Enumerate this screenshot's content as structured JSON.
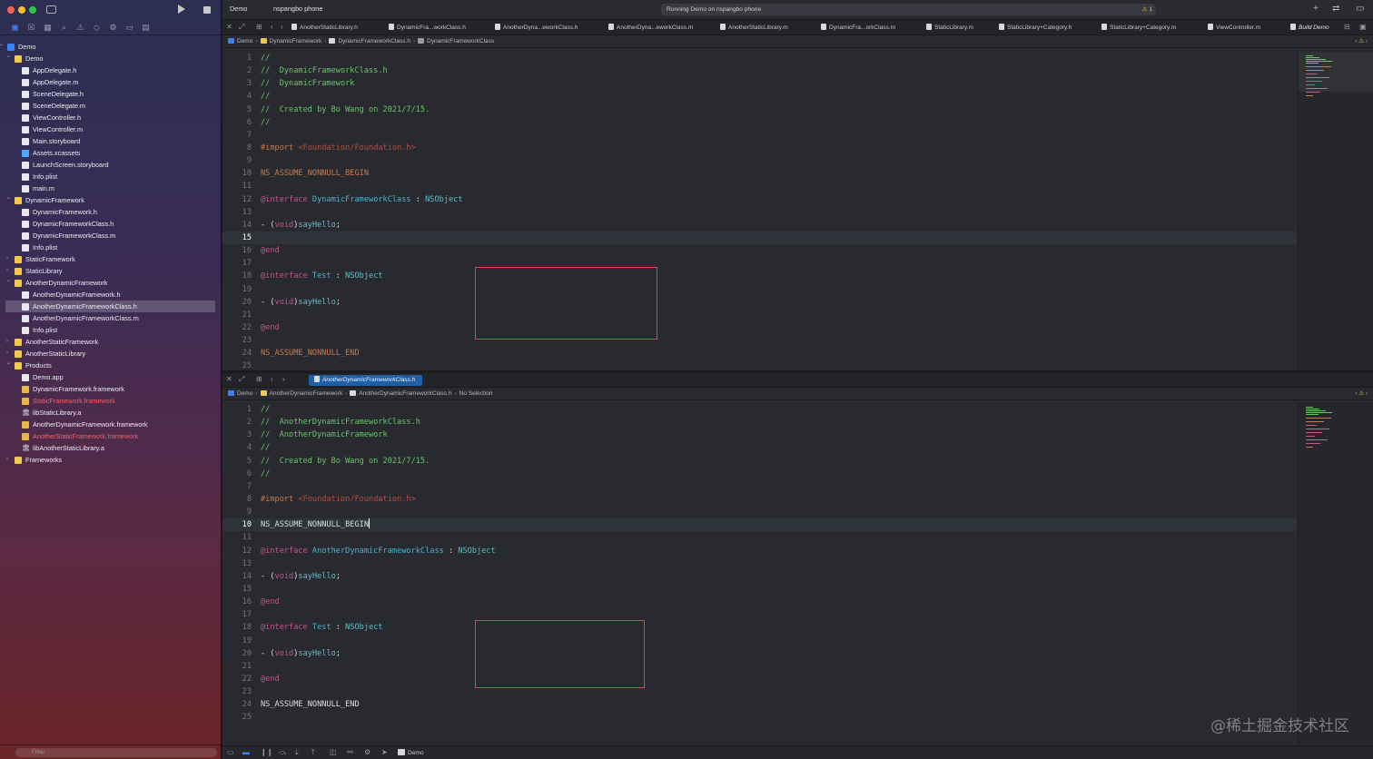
{
  "toolbar": {
    "scheme": "Demo",
    "device": "nspangbo phone",
    "status": "Running Demo on nspangbo phone",
    "warning_count": "1"
  },
  "navigator": {
    "filter_placeholder": "Filter",
    "items": [
      {
        "label": "Demo",
        "icon": "project-icon",
        "depth": 0,
        "chevron": "open"
      },
      {
        "label": "Demo",
        "icon": "folder-icon",
        "depth": 1,
        "chevron": "open"
      },
      {
        "label": "AppDelegate.h",
        "icon": "file-icon",
        "depth": 2
      },
      {
        "label": "AppDelegate.m",
        "icon": "file-icon",
        "depth": 2
      },
      {
        "label": "SceneDelegate.h",
        "icon": "file-icon",
        "depth": 2
      },
      {
        "label": "SceneDelegate.m",
        "icon": "file-icon",
        "depth": 2
      },
      {
        "label": "ViewController.h",
        "icon": "file-icon",
        "depth": 2
      },
      {
        "label": "ViewController.m",
        "icon": "file-icon",
        "depth": 2
      },
      {
        "label": "Main.storyboard",
        "icon": "file-icon",
        "depth": 2
      },
      {
        "label": "Assets.xcassets",
        "icon": "asset-catalog-icon",
        "depth": 2
      },
      {
        "label": "LaunchScreen.storyboard",
        "icon": "file-icon",
        "depth": 2
      },
      {
        "label": "Info.plist",
        "icon": "file-icon",
        "depth": 2
      },
      {
        "label": "main.m",
        "icon": "file-icon",
        "depth": 2
      },
      {
        "label": "DynamicFramework",
        "icon": "folder-icon",
        "depth": 1,
        "chevron": "open"
      },
      {
        "label": "DynamicFramework.h",
        "icon": "file-icon",
        "depth": 2
      },
      {
        "label": "DynamicFrameworkClass.h",
        "icon": "file-icon",
        "depth": 2
      },
      {
        "label": "DynamicFrameworkClass.m",
        "icon": "file-icon",
        "depth": 2
      },
      {
        "label": "Info.plist",
        "icon": "file-icon",
        "depth": 2
      },
      {
        "label": "StaticFramework",
        "icon": "folder-icon",
        "depth": 1,
        "chevron": "closed"
      },
      {
        "label": "StaticLibrary",
        "icon": "folder-icon",
        "depth": 1,
        "chevron": "closed"
      },
      {
        "label": "AnotherDynamicFramework",
        "icon": "folder-icon",
        "depth": 1,
        "chevron": "open"
      },
      {
        "label": "AnotherDynamicFramework.h",
        "icon": "file-icon",
        "depth": 2
      },
      {
        "label": "AnotherDynamicFrameworkClass.h",
        "icon": "file-icon",
        "depth": 2,
        "selected": true
      },
      {
        "label": "AnotherDynamicFrameworkClass.m",
        "icon": "file-icon",
        "depth": 2
      },
      {
        "label": "Info.plist",
        "icon": "file-icon",
        "depth": 2
      },
      {
        "label": "AnotherStaticFramework",
        "icon": "folder-icon",
        "depth": 1,
        "chevron": "closed"
      },
      {
        "label": "AnotherStaticLibrary",
        "icon": "folder-icon",
        "depth": 1,
        "chevron": "closed"
      },
      {
        "label": "Products",
        "icon": "folder-icon",
        "depth": 1,
        "chevron": "open"
      },
      {
        "label": "Demo.app",
        "icon": "app-icon",
        "depth": 2
      },
      {
        "label": "DynamicFramework.framework",
        "icon": "framework-icon",
        "depth": 2
      },
      {
        "label": "StaticFramework.framework",
        "icon": "framework-icon",
        "depth": 2,
        "missing": true
      },
      {
        "label": "libStaticLibrary.a",
        "icon": "library-icon",
        "depth": 2
      },
      {
        "label": "AnotherDynamicFramework.framework",
        "icon": "framework-icon",
        "depth": 2
      },
      {
        "label": "AnotherStaticFramework.framework",
        "icon": "framework-icon",
        "depth": 2,
        "missing": true
      },
      {
        "label": "libAnotherStaticLibrary.a",
        "icon": "library-icon",
        "depth": 2
      },
      {
        "label": "Frameworks",
        "icon": "folder-icon",
        "depth": 1,
        "chevron": "closed"
      }
    ]
  },
  "tabs": [
    {
      "label": "AnotherStaticLibrary.h"
    },
    {
      "label": "DynamicFra...workClass.h"
    },
    {
      "label": "AnotherDyna...eworkClass.h"
    },
    {
      "label": "AnotherDyna...eworkClass.m"
    },
    {
      "label": "AnotherStaticLibrary.m"
    },
    {
      "label": "DynamicFra...orkClass.m"
    },
    {
      "label": "StaticLibrary.m"
    },
    {
      "label": "StaticLibrary+Category.h"
    },
    {
      "label": "StaticLibrary+Category.m"
    },
    {
      "label": "ViewController.m"
    },
    {
      "label": "Build Demo",
      "italic": true
    }
  ],
  "pane1": {
    "breadcrumb": [
      "Demo",
      "DynamicFramework",
      "DynamicFrameworkClass.h",
      "DynamicFrameworkClass"
    ],
    "current_line": 15,
    "lines": [
      [
        [
          "c-com",
          "//"
        ]
      ],
      [
        [
          "c-com",
          "//  DynamicFrameworkClass.h"
        ]
      ],
      [
        [
          "c-com",
          "//  DynamicFramework"
        ]
      ],
      [
        [
          "c-com",
          "//"
        ]
      ],
      [
        [
          "c-com",
          "//  Created by Bo Wang on 2021/7/15."
        ]
      ],
      [
        [
          "c-com",
          "//"
        ]
      ],
      [],
      [
        [
          "c-pp",
          "#import "
        ],
        [
          "c-str",
          "<Foundation/Foundation.h>"
        ]
      ],
      [],
      [
        [
          "c-pp",
          "NS_ASSUME_NONNULL_BEGIN"
        ]
      ],
      [],
      [
        [
          "c-kw",
          "@interface "
        ],
        [
          "c-type",
          "DynamicFrameworkClass"
        ],
        [
          "",
          " : "
        ],
        [
          "c-sys",
          "NSObject"
        ]
      ],
      [],
      [
        [
          "",
          "- ("
        ],
        [
          "c-kw",
          "void"
        ],
        [
          "",
          ")"
        ],
        [
          "c-meth",
          "sayHello"
        ],
        [
          "",
          ";"
        ]
      ],
      [],
      [
        [
          "c-kw",
          "@end"
        ]
      ],
      [],
      [
        [
          "c-kw",
          "@interface "
        ],
        [
          "c-type",
          "Test"
        ],
        [
          "",
          " : "
        ],
        [
          "c-sys",
          "NSObject"
        ]
      ],
      [],
      [
        [
          "",
          "- ("
        ],
        [
          "c-kw",
          "void"
        ],
        [
          "",
          ")"
        ],
        [
          "c-meth",
          "sayHello"
        ],
        [
          "",
          ";"
        ]
      ],
      [],
      [
        [
          "c-kw",
          "@end"
        ]
      ],
      [],
      [
        [
          "c-pp",
          "NS_ASSUME_NONNULL_END"
        ]
      ],
      []
    ]
  },
  "pane2": {
    "tab_label": "AnotherDynamicFrameworkClass.h",
    "breadcrumb": [
      "Demo",
      "AnotherDynamicFramework",
      "AnotherDynamicFrameworkClass.h",
      "No Selection"
    ],
    "current_line": 10,
    "lines": [
      [
        [
          "c-com",
          "//"
        ]
      ],
      [
        [
          "c-com",
          "//  AnotherDynamicFrameworkClass.h"
        ]
      ],
      [
        [
          "c-com",
          "//  AnotherDynamicFramework"
        ]
      ],
      [
        [
          "c-com",
          "//"
        ]
      ],
      [
        [
          "c-com",
          "//  Created by Bo Wang on 2021/7/15."
        ]
      ],
      [
        [
          "c-com",
          "//"
        ]
      ],
      [],
      [
        [
          "c-pp",
          "#import "
        ],
        [
          "c-str",
          "<Foundation/Foundation.h>"
        ]
      ],
      [],
      [
        [
          "",
          "NS_ASSUME_NONNULL_BEGIN"
        ]
      ],
      [],
      [
        [
          "c-kw",
          "@interface "
        ],
        [
          "c-type",
          "AnotherDynamicFrameworkClass"
        ],
        [
          "",
          " : "
        ],
        [
          "c-sys",
          "NSObject"
        ]
      ],
      [],
      [
        [
          "",
          "- ("
        ],
        [
          "c-kw",
          "void"
        ],
        [
          "",
          ")"
        ],
        [
          "c-meth",
          "sayHello"
        ],
        [
          "",
          ";"
        ]
      ],
      [],
      [
        [
          "c-kw",
          "@end"
        ]
      ],
      [],
      [
        [
          "c-kw",
          "@interface "
        ],
        [
          "c-type",
          "Test"
        ],
        [
          "",
          " : "
        ],
        [
          "c-sys",
          "NSObject"
        ]
      ],
      [],
      [
        [
          "",
          "- ("
        ],
        [
          "c-kw",
          "void"
        ],
        [
          "",
          ")"
        ],
        [
          "c-meth",
          "sayHello"
        ],
        [
          "",
          ";"
        ]
      ],
      [],
      [
        [
          "c-kw",
          "@end"
        ]
      ],
      [],
      [
        [
          "",
          "NS_ASSUME_NONNULL_END"
        ]
      ],
      []
    ]
  },
  "debug": {
    "target": "Demo"
  },
  "watermark": "@稀土掘金技术社区"
}
